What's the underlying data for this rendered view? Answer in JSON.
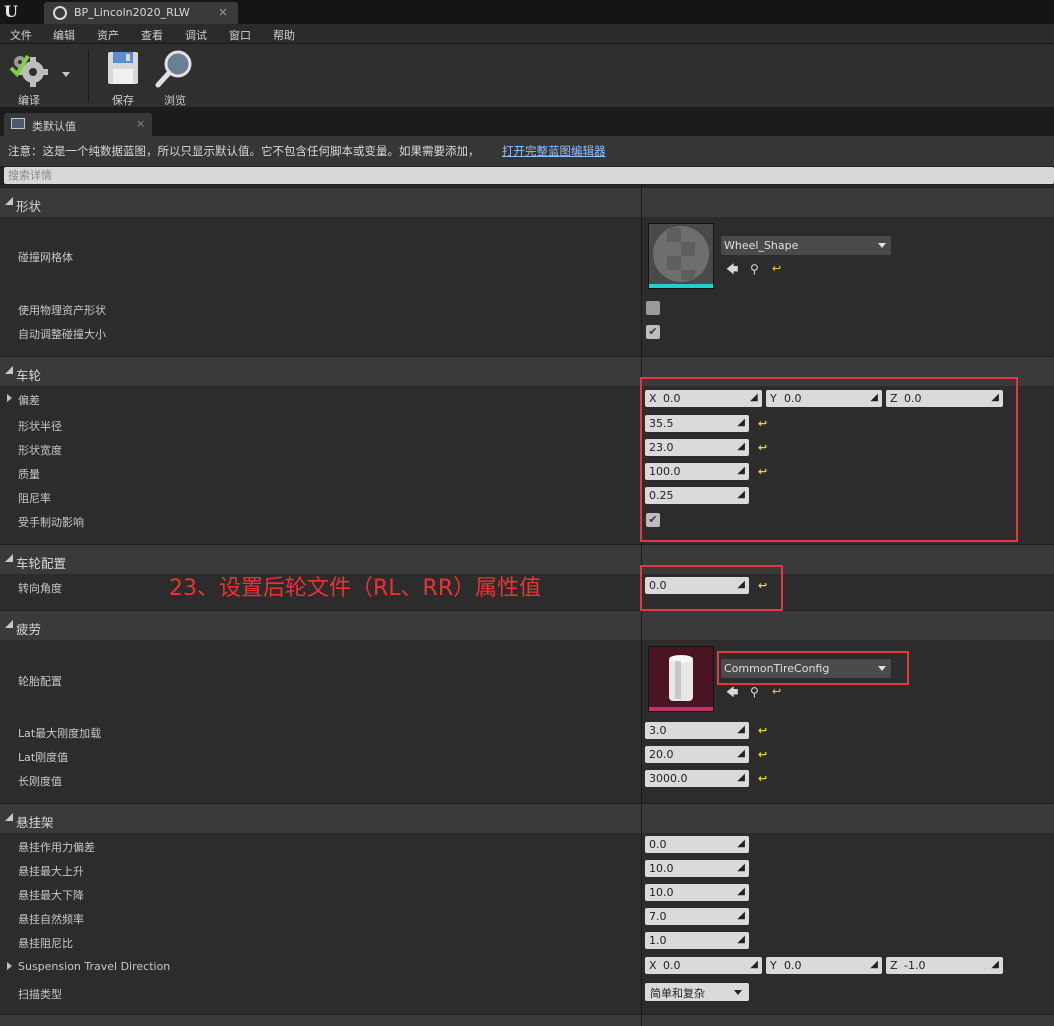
{
  "window": {
    "tab_title": "BP_Lincoln2020_RLW",
    "tab_close": "×"
  },
  "menu": [
    "文件",
    "编辑",
    "资产",
    "查看",
    "调试",
    "窗口",
    "帮助"
  ],
  "toolbar": {
    "compile": "编译",
    "save": "保存",
    "browse": "浏览"
  },
  "panel": {
    "tab_label": "类默认值",
    "tab_close": "×"
  },
  "notice": {
    "text": "注意：这是一个纯数据蓝图，所以只显示默认值。它不包含任何脚本或变量。如果需要添加，",
    "link": "打开完整蓝图编辑器"
  },
  "search": {
    "placeholder": "搜索详情"
  },
  "sections": {
    "shape": {
      "title": "形状",
      "collision_mesh": {
        "label": "碰撞网格体",
        "value": "Wheel_Shape"
      },
      "use_physics_shape": {
        "label": "使用物理资产形状",
        "checked": false
      },
      "auto_adjust": {
        "label": "自动调整碰撞大小",
        "checked": true
      }
    },
    "wheel": {
      "title": "车轮",
      "offset": {
        "label": "偏差",
        "x": "0.0",
        "y": "0.0",
        "z": "0.0"
      },
      "shape_radius": {
        "label": "形状半径",
        "value": "35.5"
      },
      "shape_width": {
        "label": "形状宽度",
        "value": "23.0"
      },
      "mass": {
        "label": "质量",
        "value": "100.0"
      },
      "damping": {
        "label": "阻尼率",
        "value": "0.25"
      },
      "affected_by_handbrake": {
        "label": "受手制动影响",
        "checked": true
      }
    },
    "wheel_setup": {
      "title": "车轮配置",
      "steer_angle": {
        "label": "转向角度",
        "value": "0.0"
      }
    },
    "tire": {
      "title": "疲劳",
      "tire_config": {
        "label": "轮胎配置",
        "value": "CommonTireConfig"
      },
      "lat_stiff_max_load": {
        "label": "Lat最大刚度加载",
        "value": "3.0"
      },
      "lat_stiff_value": {
        "label": "Lat刚度值",
        "value": "20.0"
      },
      "long_stiff_value": {
        "label": "长刚度值",
        "value": "3000.0"
      }
    },
    "suspension": {
      "title": "悬挂架",
      "force_offset": {
        "label": "悬挂作用力偏差",
        "value": "0.0"
      },
      "max_raise": {
        "label": "悬挂最大上升",
        "value": "10.0"
      },
      "max_drop": {
        "label": "悬挂最大下降",
        "value": "10.0"
      },
      "natural_freq": {
        "label": "悬挂自然频率",
        "value": "7.0"
      },
      "damping_ratio": {
        "label": "悬挂阻尼比",
        "value": "1.0"
      },
      "travel_direction": {
        "label": "Suspension Travel Direction",
        "x": "0.0",
        "y": "0.0",
        "z": "-1.0"
      },
      "sweep_type": {
        "label": "扫描类型",
        "value": "简单和复杂"
      }
    }
  },
  "annotation": "23、设置后轮文件（RL、RR）属性值",
  "colors": {
    "annotation": "#ea3232",
    "reset_arrow": "#f2d830",
    "link": "#8ec0ff"
  }
}
